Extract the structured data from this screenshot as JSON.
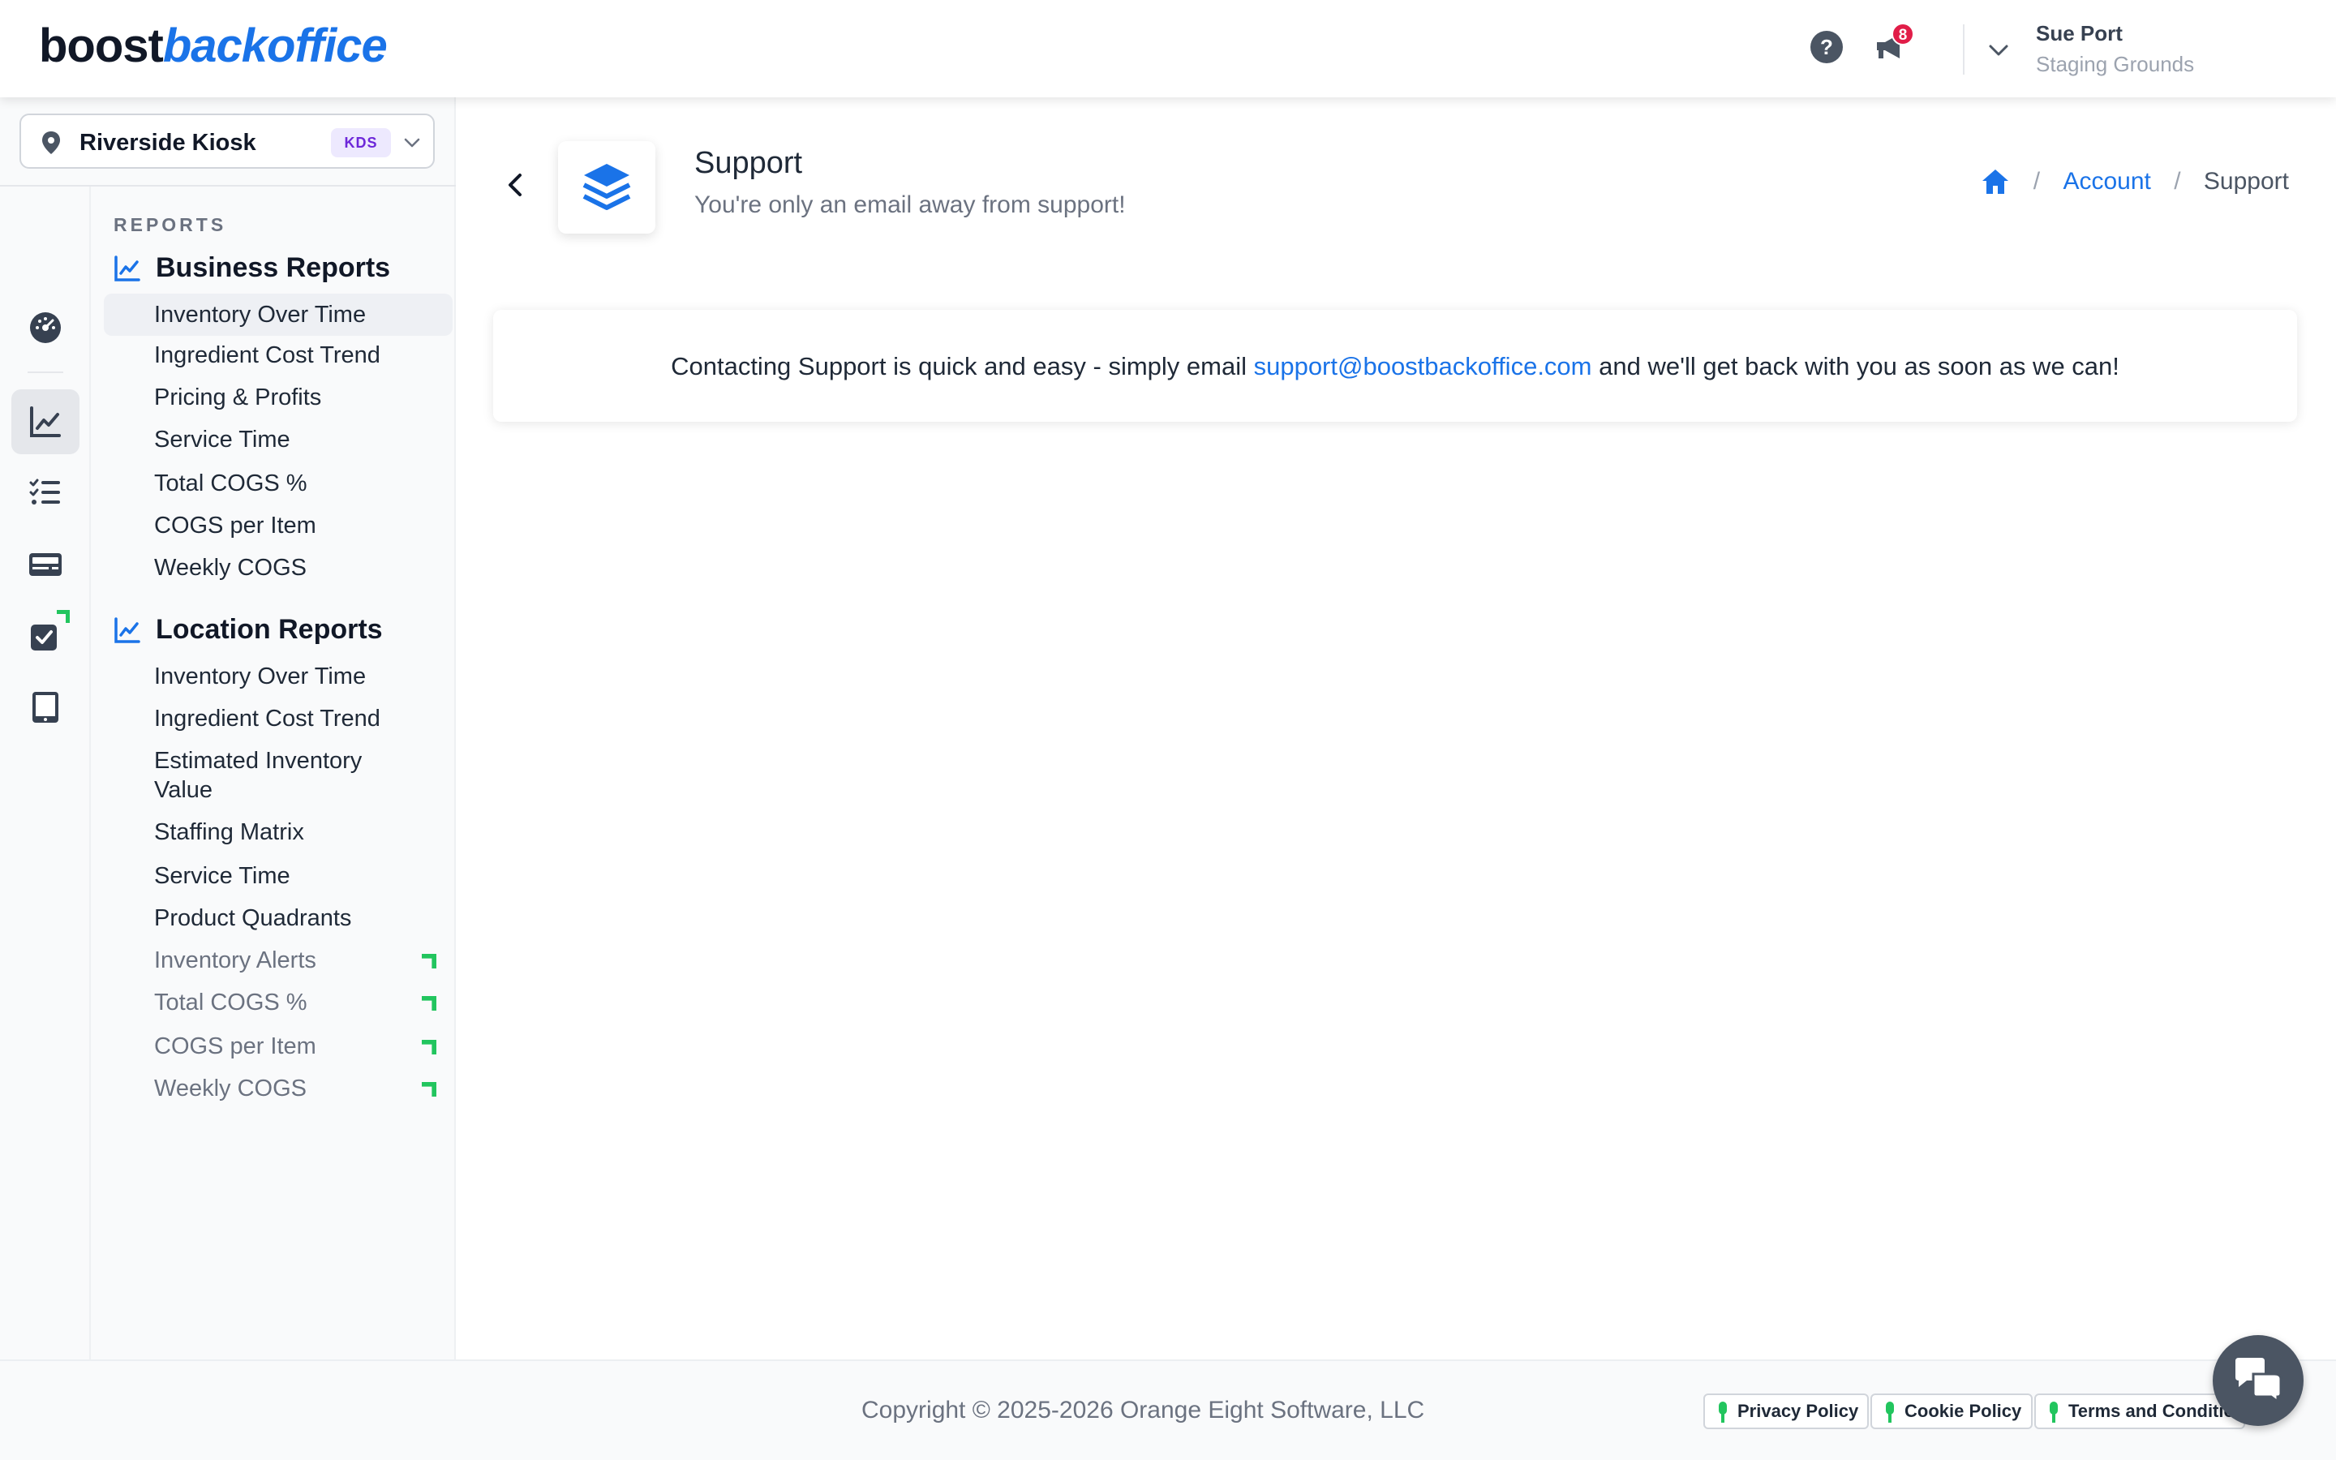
{
  "header": {
    "logo_part1": "boost",
    "logo_part2": "backoffice",
    "notification_count": "8",
    "user_name": "Sue Port",
    "user_org": "Staging Grounds"
  },
  "sidebar": {
    "location_name": "Riverside Kiosk",
    "location_badge": "KDS",
    "reports_heading": "REPORTS",
    "business_reports": {
      "title": "Business Reports",
      "items": [
        {
          "label": "Inventory Over Time",
          "active": true
        },
        {
          "label": "Ingredient Cost Trend"
        },
        {
          "label": "Pricing & Profits"
        },
        {
          "label": "Service Time"
        },
        {
          "label": "Total COGS %"
        },
        {
          "label": "COGS per Item"
        },
        {
          "label": "Weekly COGS"
        }
      ]
    },
    "location_reports": {
      "title": "Location Reports",
      "items": [
        {
          "label": "Inventory Over Time"
        },
        {
          "label": "Ingredient Cost Trend"
        },
        {
          "label": "Estimated Inventory Value"
        },
        {
          "label": "Staffing Matrix"
        },
        {
          "label": "Service Time"
        },
        {
          "label": "Product Quadrants"
        },
        {
          "label": "Inventory Alerts",
          "flag": true
        },
        {
          "label": "Total COGS %",
          "flag": true
        },
        {
          "label": "COGS per Item",
          "flag": true
        },
        {
          "label": "Weekly COGS",
          "flag": true
        }
      ]
    },
    "rail_icons": [
      "dashboard-icon",
      "reports-chart-icon",
      "checklist-icon",
      "pos-terminal-icon",
      "task-check-icon",
      "tablet-icon"
    ]
  },
  "page": {
    "title": "Support",
    "subtitle": "You're only an email away from support!",
    "breadcrumb": {
      "account": "Account",
      "current": "Support",
      "separator": "/"
    },
    "support_text_before": "Contacting Support is quick and easy - simply email ",
    "support_email": "support@boostbackoffice.com",
    "support_text_after": " and we'll get back with you as soon as we can!"
  },
  "footer": {
    "copyright": "Copyright © 2025-2026 Orange Eight Software, LLC",
    "privacy": "Privacy Policy",
    "cookie": "Cookie Policy",
    "terms": "Terms and Conditions"
  },
  "colors": {
    "accent": "#1a73e8",
    "badge": "#e11d48",
    "new_flag": "#22c55e",
    "kds_badge_bg": "#ede9fe",
    "kds_badge_text": "#6d28d9"
  }
}
